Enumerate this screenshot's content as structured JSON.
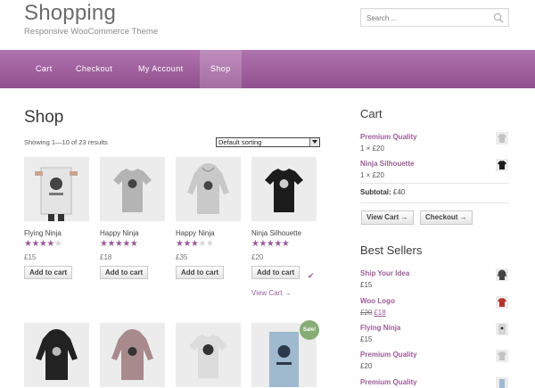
{
  "header": {
    "site_title": "Shopping",
    "site_description": "Responsive WooCommerce Theme",
    "search_placeholder": "Search ..."
  },
  "nav": {
    "items": [
      {
        "label": "Cart"
      },
      {
        "label": "Checkout"
      },
      {
        "label": "My Account"
      },
      {
        "label": "Shop",
        "active": true
      }
    ]
  },
  "shop": {
    "title": "Shop",
    "result_count": "Showing 1—10 of 23 results",
    "sort_selected": "Default sorting",
    "add_to_cart_label": "Add to cart",
    "view_cart_label": "View Cart →",
    "sale_badge": "Sale!",
    "products": [
      {
        "name": "Flying Ninja",
        "rating": 4,
        "price": "£15",
        "image": "poster-icon"
      },
      {
        "name": "Happy Ninja",
        "rating": 5,
        "price": "£18",
        "image": "tshirt-icon"
      },
      {
        "name": "Happy Ninja",
        "rating": 3,
        "price": "£35",
        "image": "hoodie-icon"
      },
      {
        "name": "Ninja Silhouette",
        "rating": 5,
        "price": "£20",
        "image": "tshirt-icon"
      }
    ],
    "products_row2": [
      {
        "image": "hoodie-icon"
      },
      {
        "image": "hoodie-icon"
      },
      {
        "image": "tshirt-icon"
      },
      {
        "image": "poster-icon"
      }
    ]
  },
  "sidebar": {
    "cart_title": "Cart",
    "cart_items": [
      {
        "name": "Premium Quality",
        "qty": "1 × £20"
      },
      {
        "name": "Ninja Silhouette",
        "qty": "1 × £20"
      }
    ],
    "subtotal_label": "Subtotal:",
    "subtotal_value": "£40",
    "view_cart_button": "View Cart →",
    "checkout_button": "Checkout →",
    "best_sellers_title": "Best Sellers",
    "best_sellers": [
      {
        "name": "Ship Your Idea",
        "price": "£15"
      },
      {
        "name": "Woo Logo",
        "old_price": "£20",
        "price": "£18"
      },
      {
        "name": "Flying Ninja",
        "price": "£15"
      },
      {
        "name": "Premium Quality",
        "price": "£20"
      },
      {
        "name": "Premium Quality",
        "price": ""
      }
    ]
  },
  "colors": {
    "accent": "#9b5c98",
    "nav_top": "#b073ae",
    "nav_bottom": "#91508f",
    "sale_badge": "#85ad74"
  }
}
